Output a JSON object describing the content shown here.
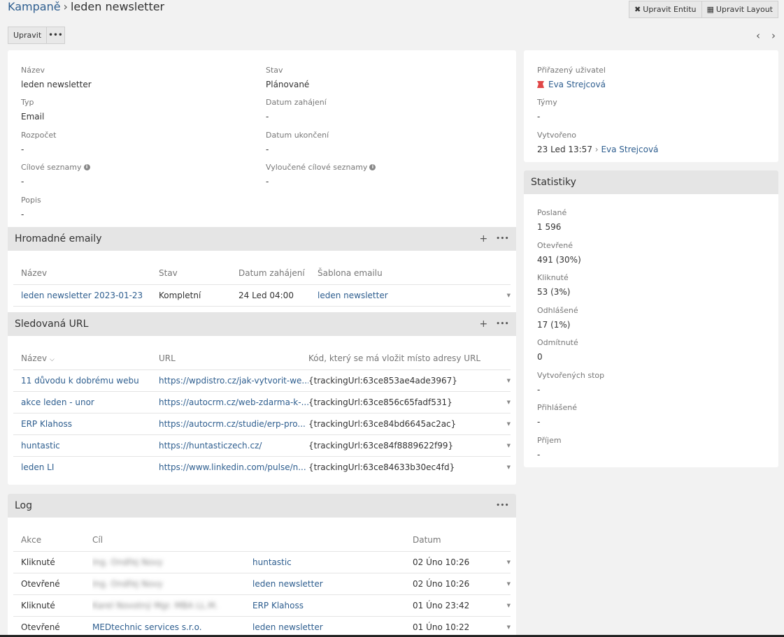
{
  "header": {
    "crumb": "Kampaně",
    "separator": "›",
    "title": "leden newsletter"
  },
  "top_buttons": {
    "edit_entity": "Upravit Entitu",
    "edit_layout": "Upravit Layout"
  },
  "action_bar": {
    "edit": "Upravit",
    "more": "•••"
  },
  "pager": {
    "prev": "‹",
    "next": "›"
  },
  "overview": {
    "name_label": "Název",
    "name_value": "leden newsletter",
    "status_label": "Stav",
    "status_value": "Plánované",
    "type_label": "Typ",
    "type_value": "Email",
    "start_label": "Datum zahájení",
    "start_value": "-",
    "budget_label": "Rozpočet",
    "budget_value": "-",
    "end_label": "Datum ukončení",
    "end_value": "-",
    "target_label": "Cílové seznamy",
    "target_value": "-",
    "excluded_label": "Vyloučené cílové seznamy",
    "excluded_value": "-",
    "desc_label": "Popis",
    "desc_value": "-"
  },
  "mass_emails": {
    "title": "Hromadné emaily",
    "columns": [
      "Název",
      "Stav",
      "Datum zahájení",
      "Šablona emailu"
    ],
    "rows": [
      {
        "name": "leden newsletter 2023-01-23",
        "status": "Kompletní",
        "date": "24 Led 04:00",
        "template": "leden newsletter"
      }
    ]
  },
  "tracked_urls": {
    "title": "Sledovaná URL",
    "columns": [
      "Název",
      "URL",
      "Kód, který se má vložit místo adresy URL"
    ],
    "rows": [
      {
        "name": "11 důvodu k dobrému webu",
        "url": "https://wpdistro.cz/jak-vytvorit-we...",
        "code": "{trackingUrl:63ce853ae4ade3967}"
      },
      {
        "name": "akce leden - unor",
        "url": "https://autocrm.cz/web-zdarma-k-...",
        "code": "{trackingUrl:63ce856c65fadf531}"
      },
      {
        "name": "ERP Klahoss",
        "url": "https://autocrm.cz/studie/erp-pro...",
        "code": "{trackingUrl:63ce84bd6645ac2ac}"
      },
      {
        "name": "huntastic",
        "url": "https://huntasticzech.cz/",
        "code": "{trackingUrl:63ce84f8889622f99}"
      },
      {
        "name": "leden LI",
        "url": "https://www.linkedin.com/pulse/n...",
        "code": "{trackingUrl:63ce84633b30ec4fd}"
      }
    ]
  },
  "log": {
    "title": "Log",
    "columns": [
      "Akce",
      "Cíl",
      "",
      "Datum"
    ],
    "rows": [
      {
        "action": "Kliknuté",
        "target": "Ing. Ondřej Novy",
        "object": "huntastic",
        "date": "02 Úno 10:26"
      },
      {
        "action": "Otevřené",
        "target": "Ing. Ondřej Novy",
        "object": "leden newsletter",
        "date": "02 Úno 10:26"
      },
      {
        "action": "Kliknuté",
        "target": "Karel Novotný Mgr. MBA LL.M.",
        "object": "ERP Klahoss",
        "date": "01 Úno 23:42"
      },
      {
        "action": "Otevřené",
        "target": "MEDtechnic services s.r.o.",
        "object": "leden newsletter",
        "date": "01 Úno 10:22"
      }
    ]
  },
  "side": {
    "assigned_label": "Přiřazený uživatel",
    "assigned_value": "Eva Strejcová",
    "teams_label": "Týmy",
    "teams_value": "-",
    "created_label": "Vytvořeno",
    "created_date": "23 Led 13:57",
    "created_arrow": "›",
    "created_by": "Eva Strejcová"
  },
  "stats": {
    "title": "Statistiky",
    "items": [
      {
        "label": "Poslané",
        "value": "1 596"
      },
      {
        "label": "Otevřené",
        "value": "491 (30%)"
      },
      {
        "label": "Kliknuté",
        "value": "53 (3%)"
      },
      {
        "label": "Odhlášené",
        "value": "17 (1%)"
      },
      {
        "label": "Odmítnuté",
        "value": "0"
      },
      {
        "label": "Vytvořených stop",
        "value": "-"
      },
      {
        "label": "Přihlášené",
        "value": "-"
      },
      {
        "label": "Příjem",
        "value": "-"
      }
    ]
  },
  "colors": {
    "link": "#2e5e8f",
    "panel_header": "#e5e5e5",
    "background": "#f2f2f2"
  }
}
